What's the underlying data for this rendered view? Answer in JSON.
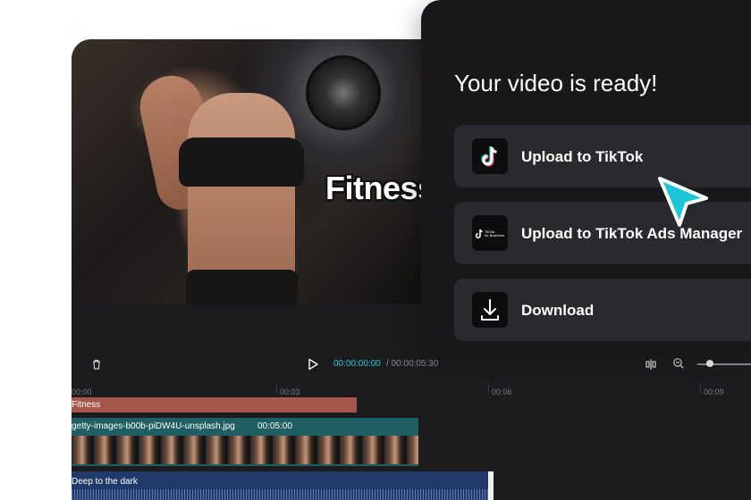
{
  "preview": {
    "caption": "Fitness"
  },
  "toolbar": {
    "time_current": "00:00:00:00",
    "time_total": "/ 00:00:05:30"
  },
  "ruler": {
    "labels": [
      "00:00",
      "00:03",
      "00:06",
      "00:09"
    ]
  },
  "tracks": {
    "text": {
      "label": "Fitness",
      "color": "#a4574a"
    },
    "video": {
      "label": "getty-images-b00b-piDW4U-unsplash.jpg",
      "duration": "00:05:00",
      "color": "#1f5e63"
    },
    "audio": {
      "label": "Deep to the dark",
      "color": "#223a6a"
    }
  },
  "panel": {
    "title": "Your video is ready!",
    "options": [
      {
        "label": "Upload to TikTok",
        "icon": "tiktok-icon"
      },
      {
        "label": "Upload to TikTok Ads Manager",
        "icon": "tiktok-business-icon",
        "icon_text_1": "TikTok",
        "icon_text_2": "for Business"
      },
      {
        "label": "Download",
        "icon": "download-icon"
      }
    ]
  },
  "colors": {
    "accent": "#2ec4d6",
    "cursor": "#1bc6d8"
  }
}
